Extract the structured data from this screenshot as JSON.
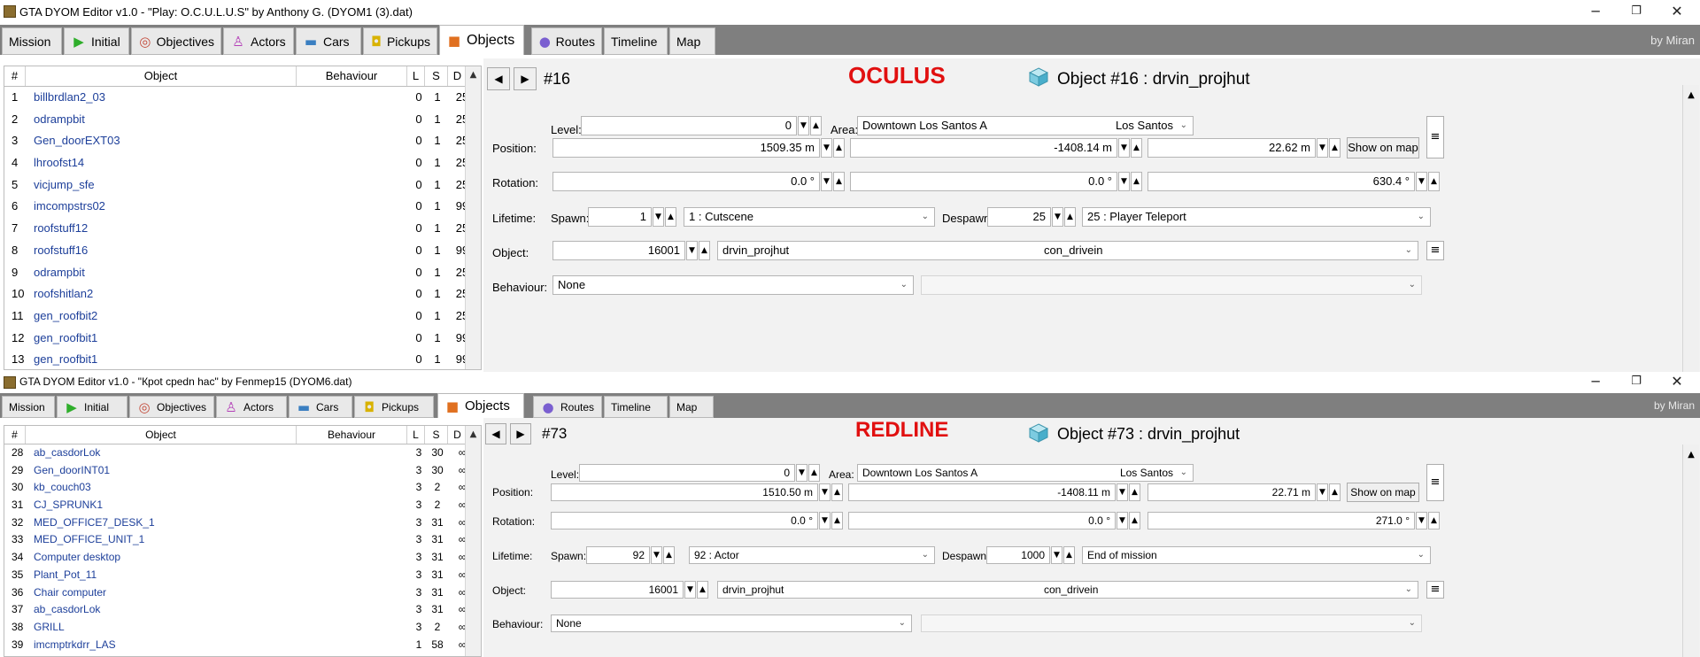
{
  "windows": [
    {
      "title": "GTA DYOM Editor v1.0    -    \"Play: O.C.U.L.U.S\"  by  Anthony G.  (DYOM1 (3).dat)",
      "window_controls": {
        "minimize": "─",
        "maximize": "❐",
        "close": "✕"
      },
      "tabs": [
        {
          "label": "Mission",
          "icon": ""
        },
        {
          "label": "Initial",
          "icon": "initial-play-icon"
        },
        {
          "label": "Objectives",
          "icon": "objectives-target-icon"
        },
        {
          "label": "Actors",
          "icon": "actors-person-icon"
        },
        {
          "label": "Cars",
          "icon": "cars-car-icon"
        },
        {
          "label": "Pickups",
          "icon": "pickups-bag-icon"
        },
        {
          "label": "Objects",
          "icon": "objects-box-icon",
          "active": true
        },
        {
          "label": "Routes",
          "icon": "routes-circle-icon"
        },
        {
          "label": "Timeline",
          "icon": ""
        },
        {
          "label": "Map",
          "icon": ""
        }
      ],
      "credit": "by Miran",
      "list": {
        "headers": {
          "num": "#",
          "object": "Object",
          "behaviour": "Behaviour",
          "l": "L",
          "s": "S",
          "d": "D"
        },
        "rows": [
          {
            "num": "1",
            "object": "billbrdlan2_03",
            "l": "0",
            "s": "1",
            "d": "25"
          },
          {
            "num": "2",
            "object": "odrampbit",
            "l": "0",
            "s": "1",
            "d": "25"
          },
          {
            "num": "3",
            "object": "Gen_doorEXT03",
            "l": "0",
            "s": "1",
            "d": "25"
          },
          {
            "num": "4",
            "object": "lhroofst14",
            "l": "0",
            "s": "1",
            "d": "25"
          },
          {
            "num": "5",
            "object": "vicjump_sfe",
            "l": "0",
            "s": "1",
            "d": "25"
          },
          {
            "num": "6",
            "object": "imcompstrs02",
            "l": "0",
            "s": "1",
            "d": "99"
          },
          {
            "num": "7",
            "object": "roofstuff12",
            "l": "0",
            "s": "1",
            "d": "25"
          },
          {
            "num": "8",
            "object": "roofstuff16",
            "l": "0",
            "s": "1",
            "d": "99"
          },
          {
            "num": "9",
            "object": "odrampbit",
            "l": "0",
            "s": "1",
            "d": "25"
          },
          {
            "num": "10",
            "object": "roofshitlan2",
            "l": "0",
            "s": "1",
            "d": "25"
          },
          {
            "num": "11",
            "object": "gen_roofbit2",
            "l": "0",
            "s": "1",
            "d": "25"
          },
          {
            "num": "12",
            "object": "gen_roofbit1",
            "l": "0",
            "s": "1",
            "d": "99"
          },
          {
            "num": "13",
            "object": "gen_roofbit1",
            "l": "0",
            "s": "1",
            "d": "99"
          }
        ]
      },
      "editor": {
        "nav_prev": "◀",
        "nav_next": "▶",
        "id": "#16",
        "red_title": "OCULUS",
        "object_header": "Object #16 : drvin_projhut",
        "labels": {
          "level": "Level:",
          "area": "Area:",
          "position": "Position:",
          "rotation": "Rotation:",
          "lifetime": "Lifetime:",
          "spawn": "Spawn:",
          "despawn": "Despawn:",
          "object": "Object:",
          "behaviour": "Behaviour:"
        },
        "level": "0",
        "area_name": "Downtown Los Santos A",
        "area_city": "Los Santos",
        "pos_x": "1509.35 m",
        "pos_y": "-1408.14 m",
        "pos_z": "22.62 m",
        "show_on_map": "Show on map",
        "rot_x": "0.0 °",
        "rot_y": "0.0 °",
        "rot_z": "630.4 °",
        "spawn_value": "1",
        "spawn_option": "1 : Cutscene",
        "despawn_value": "25",
        "despawn_option": "25 : Player Teleport",
        "object_id": "16001",
        "object_model": "drvin_projhut",
        "object_group": "con_drivein",
        "behaviour": "None"
      }
    },
    {
      "title": "GTA DYOM Editor v1.0    -    \"Кpot cpedn hac\"  by  Fenmep15  (DYOM6.dat)",
      "window_controls": {
        "minimize": "─",
        "maximize": "❐",
        "close": "✕"
      },
      "tabs": [
        {
          "label": "Mission",
          "icon": ""
        },
        {
          "label": "Initial",
          "icon": "initial-play-icon"
        },
        {
          "label": "Objectives",
          "icon": "objectives-target-icon"
        },
        {
          "label": "Actors",
          "icon": "actors-person-icon"
        },
        {
          "label": "Cars",
          "icon": "cars-car-icon"
        },
        {
          "label": "Pickups",
          "icon": "pickups-bag-icon"
        },
        {
          "label": "Objects",
          "icon": "objects-box-icon",
          "active": true
        },
        {
          "label": "Routes",
          "icon": "routes-circle-icon"
        },
        {
          "label": "Timeline",
          "icon": ""
        },
        {
          "label": "Map",
          "icon": ""
        }
      ],
      "credit": "by Miran",
      "list": {
        "headers": {
          "num": "#",
          "object": "Object",
          "behaviour": "Behaviour",
          "l": "L",
          "s": "S",
          "d": "D"
        },
        "rows": [
          {
            "num": "28",
            "object": "ab_casdorLok",
            "l": "3",
            "s": "30",
            "d": "∞"
          },
          {
            "num": "29",
            "object": "Gen_doorINT01",
            "l": "3",
            "s": "30",
            "d": "∞"
          },
          {
            "num": "30",
            "object": "kb_couch03",
            "l": "3",
            "s": "2",
            "d": "∞"
          },
          {
            "num": "31",
            "object": "CJ_SPRUNK1",
            "l": "3",
            "s": "2",
            "d": "∞"
          },
          {
            "num": "32",
            "object": "MED_OFFICE7_DESK_1",
            "l": "3",
            "s": "31",
            "d": "∞"
          },
          {
            "num": "33",
            "object": "MED_OFFICE_UNIT_1",
            "l": "3",
            "s": "31",
            "d": "∞"
          },
          {
            "num": "34",
            "object": "Computer desktop",
            "l": "3",
            "s": "31",
            "d": "∞"
          },
          {
            "num": "35",
            "object": "Plant_Pot_11",
            "l": "3",
            "s": "31",
            "d": "∞"
          },
          {
            "num": "36",
            "object": "Chair computer",
            "l": "3",
            "s": "31",
            "d": "∞"
          },
          {
            "num": "37",
            "object": "ab_casdorLok",
            "l": "3",
            "s": "31",
            "d": "∞"
          },
          {
            "num": "38",
            "object": "GRILL",
            "l": "3",
            "s": "2",
            "d": "∞"
          },
          {
            "num": "39",
            "object": "imcmptrkdrr_LAS",
            "l": "1",
            "s": "58",
            "d": "∞"
          }
        ]
      },
      "editor": {
        "nav_prev": "◀",
        "nav_next": "▶",
        "id": "#73",
        "red_title": "REDLINE",
        "object_header": "Object #73 : drvin_projhut",
        "labels": {
          "level": "Level:",
          "area": "Area:",
          "position": "Position:",
          "rotation": "Rotation:",
          "lifetime": "Lifetime:",
          "spawn": "Spawn:",
          "despawn": "Despawn:",
          "object": "Object:",
          "behaviour": "Behaviour:"
        },
        "level": "0",
        "area_name": "Downtown Los Santos A",
        "area_city": "Los Santos",
        "pos_x": "1510.50 m",
        "pos_y": "-1408.11 m",
        "pos_z": "22.71 m",
        "show_on_map": "Show on map",
        "rot_x": "0.0 °",
        "rot_y": "0.0 °",
        "rot_z": "271.0 °",
        "spawn_value": "92",
        "spawn_option": "92 : Actor",
        "despawn_value": "1000",
        "despawn_option": "End of mission",
        "object_id": "16001",
        "object_model": "drvin_projhut",
        "object_group": "con_drivein",
        "behaviour": "None"
      }
    }
  ]
}
